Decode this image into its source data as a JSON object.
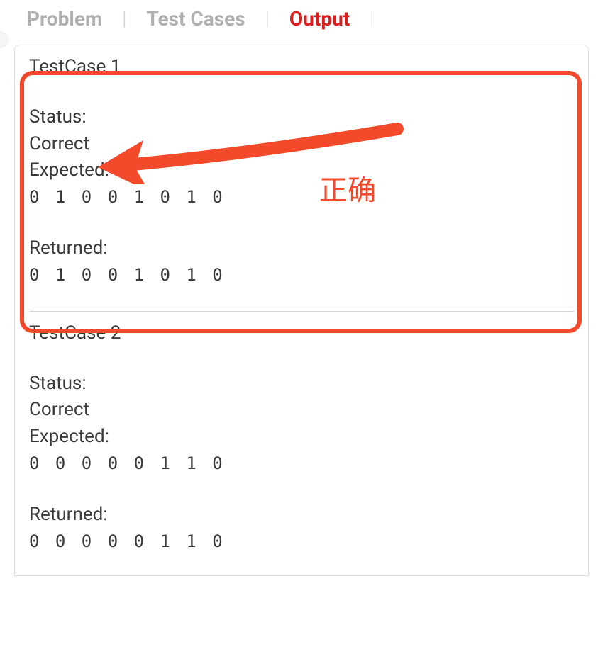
{
  "tabs": {
    "problem": "Problem",
    "testcases": "Test Cases",
    "output": "Output"
  },
  "output": {
    "testcases": [
      {
        "title": "TestCase 1",
        "status_label": "Status:",
        "status_value": "Correct",
        "expected_label": "Expected:",
        "expected_value": "0 1 0 0 1 0 1 0",
        "returned_label": "Returned:",
        "returned_value": "0 1 0 0 1 0 1 0"
      },
      {
        "title": "TestCase 2",
        "status_label": "Status:",
        "status_value": "Correct",
        "expected_label": "Expected:",
        "expected_value": "0 0 0 0 0 1 1 0",
        "returned_label": "Returned:",
        "returned_value": "0 0 0 0 0 1 1 0"
      }
    ]
  },
  "annotation": {
    "text": "正确"
  }
}
